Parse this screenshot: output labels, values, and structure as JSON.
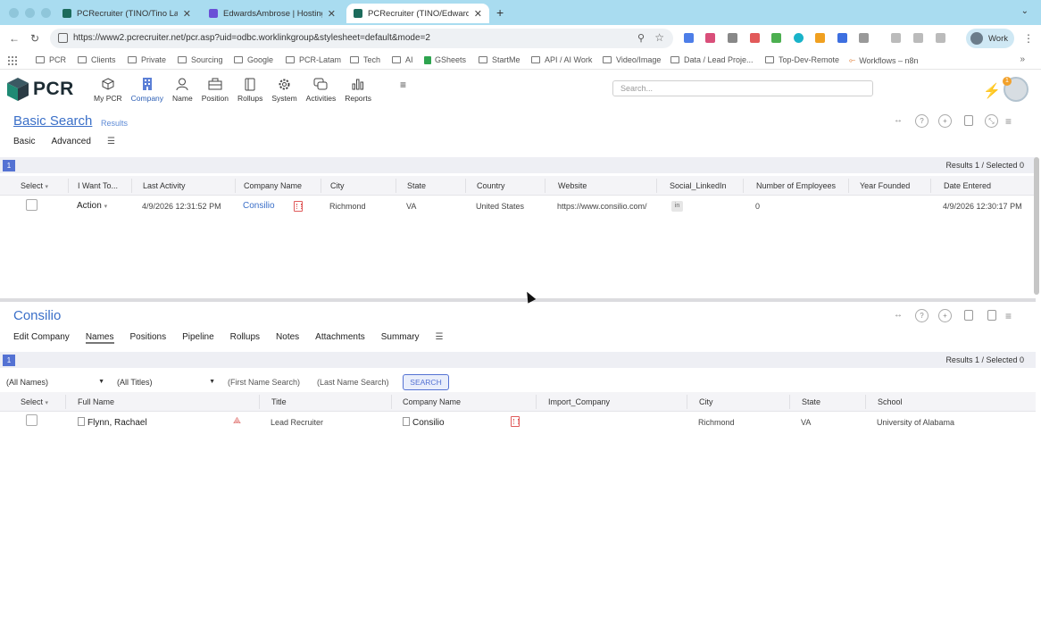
{
  "browser": {
    "tabs": [
      {
        "title": "PCRecruiter (TINO/Tino Lang)",
        "active": false
      },
      {
        "title": "EdwardsAmbrose | Hostinger",
        "active": false
      },
      {
        "title": "PCRecruiter (TINO/Edward Ambrose)",
        "active": true
      }
    ],
    "url": "https://www2.pcrecruiter.net/pcr.asp?uid=odbc.worklinkgroup&stylesheet=default&mode=2",
    "profile_label": "Work",
    "bookmarks": [
      "PCR",
      "Clients",
      "Private",
      "Sourcing",
      "Google",
      "PCR-Latam",
      "Tech",
      "AI",
      "GSheets",
      "StartMe",
      "API / AI Work",
      "Video/Image",
      "Data / Lead Proje...",
      "Top-Dev-Remote",
      "Workflows – n8n"
    ]
  },
  "app": {
    "logo_text": "PCR",
    "nav": [
      {
        "label": "My PCR",
        "icon": "cube-icon"
      },
      {
        "label": "Company",
        "icon": "building-icon"
      },
      {
        "label": "Name",
        "icon": "person-icon"
      },
      {
        "label": "Position",
        "icon": "briefcase-icon"
      },
      {
        "label": "Rollups",
        "icon": "document-icon"
      },
      {
        "label": "System",
        "icon": "gear-icon"
      },
      {
        "label": "Activities",
        "icon": "chat-icon"
      },
      {
        "label": "Reports",
        "icon": "bar-chart-icon"
      }
    ],
    "search_placeholder": "Search...",
    "notification_count": "1"
  },
  "search_panel": {
    "title": "Basic Search",
    "subtitle": "Results",
    "tabs": [
      "Basic",
      "Advanced"
    ],
    "page": "1",
    "results_text": "Results 1 / Selected 0",
    "columns": [
      "Select",
      "I Want To...",
      "Last Activity",
      "Company Name",
      "City",
      "State",
      "Country",
      "Website",
      "Social_LinkedIn",
      "Number of Employees",
      "Year Founded",
      "Date Entered"
    ],
    "row": {
      "action": "Action",
      "last_activity": "4/9/2026 12:31:52 PM",
      "company_name": "Consilio",
      "city": "Richmond",
      "state": "VA",
      "country": "United States",
      "website": "https://www.consilio.com/",
      "linkedin_icon": "in",
      "employees": "0",
      "year_founded": "",
      "date_entered": "4/9/2026 12:30:17 PM"
    }
  },
  "company_panel": {
    "title": "Consilio",
    "tabs": [
      "Edit Company",
      "Names",
      "Positions",
      "Pipeline",
      "Rollups",
      "Notes",
      "Attachments",
      "Summary"
    ],
    "active_tab": "Names",
    "page": "1",
    "results_text": "Results 1 / Selected 0",
    "filters": {
      "names": "(All Names)",
      "titles": "(All Titles)",
      "first_name_placeholder": "(First Name Search)",
      "last_name_placeholder": "(Last Name Search)",
      "search_button": "SEARCH"
    },
    "columns": [
      "Select",
      "Full Name",
      "Title",
      "Company Name",
      "Import_Company",
      "City",
      "State",
      "School"
    ],
    "row": {
      "full_name": "Flynn, Rachael",
      "title": "Lead Recruiter",
      "company_name": "Consilio",
      "import_company": "",
      "city": "Richmond",
      "state": "VA",
      "school": "University of Alabama"
    }
  },
  "colors": {
    "accent": "#3a6fc8",
    "page_badge": "#5472d3",
    "icon_red": "#e05c5c",
    "tabbar": "#a9dcf0"
  }
}
